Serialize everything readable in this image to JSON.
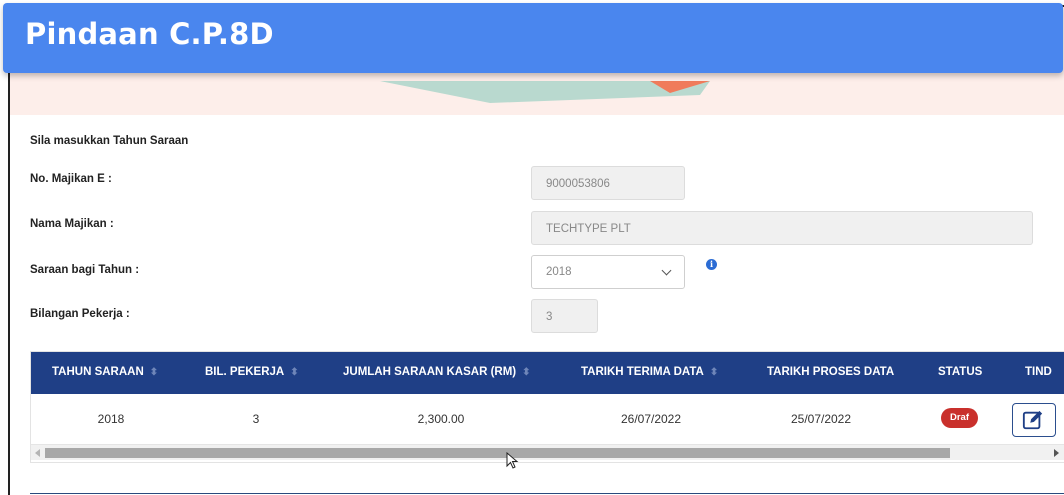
{
  "header": {
    "title": "Pindaan C.P.8D"
  },
  "form": {
    "intro": "Sila masukkan Tahun Saraan",
    "employer_no_label": "No. Majikan E :",
    "employer_no_value": "9000053806",
    "employer_name_label": "Nama Majikan :",
    "employer_name_value": "TECHTYPE PLT",
    "year_label": "Saraan bagi Tahun :",
    "year_value": "2018",
    "workers_label": "Bilangan Pekerja :",
    "workers_value": "3"
  },
  "table": {
    "headers": [
      "TAHUN SARAAN",
      "BIL. PEKERJA",
      "JUMLAH SARAAN KASAR (RM)",
      "TARIKH TERIMA DATA",
      "TARIKH PROSES DATA",
      "STATUS",
      "TIND"
    ],
    "rows": [
      {
        "year": "2018",
        "workers": "3",
        "amount": "2,300.00",
        "received": "26/07/2022",
        "processed": "25/07/2022",
        "status": "Draf"
      }
    ]
  },
  "colors": {
    "header": "#4a86ee",
    "table_header": "#1f3f86",
    "status_draft": "#c9302c"
  },
  "icons": {
    "info": "info-circle-icon",
    "edit": "edit-icon",
    "dropdown": "chevron-down-icon"
  }
}
